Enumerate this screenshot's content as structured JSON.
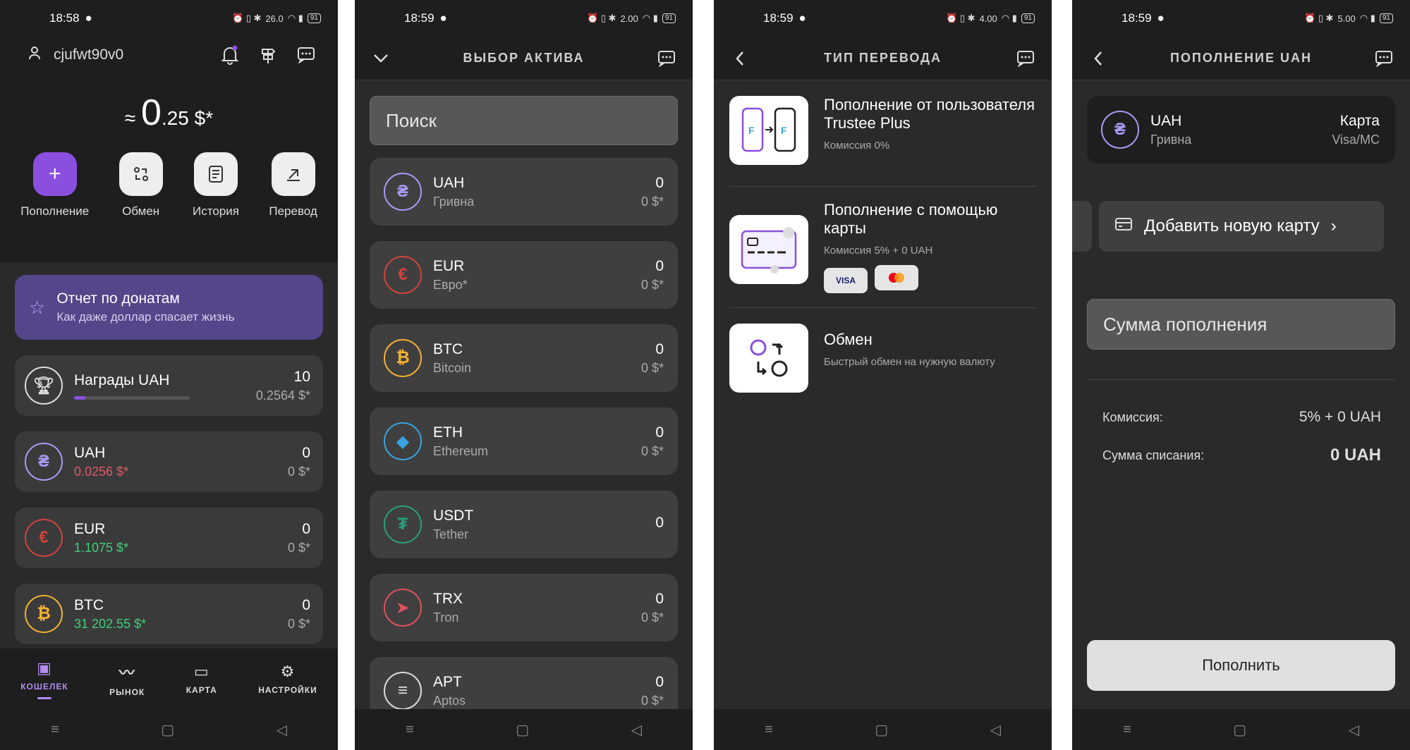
{
  "status": {
    "s1_time": "18:58",
    "s2_time": "18:59",
    "s3_time": "18:59",
    "s4_time": "18:59",
    "net1": "26.0",
    "net2": "2.00",
    "net3": "4.00",
    "net4": "5.00",
    "battery": "91"
  },
  "wallet": {
    "username": "cjufwt90v0",
    "balance_prefix": "≈",
    "balance_int": "0",
    "balance_dec": ".25 $*",
    "actions": [
      {
        "label": "Пополнение"
      },
      {
        "label": "Обмен"
      },
      {
        "label": "История"
      },
      {
        "label": "Перевод"
      }
    ],
    "banner": {
      "title": "Отчет по донатам",
      "subtitle": "Как даже доллар спасает жизнь"
    },
    "rewards": {
      "name": "Награды UAH",
      "amount": "10",
      "usd": "0.2564 $*",
      "progress": 0.1
    },
    "assets": [
      {
        "name": "UAH",
        "rate": "0.0256 $*",
        "amount": "0",
        "usd": "0 $*",
        "rate_color": "#e05a6a"
      },
      {
        "name": "EUR",
        "rate": "1.1075 $*",
        "amount": "0",
        "usd": "0 $*",
        "rate_color": "#3ecf7a"
      },
      {
        "name": "BTC",
        "rate": "31 202.55 $*",
        "amount": "0",
        "usd": "0 $*",
        "rate_color": "#3ecf7a"
      }
    ],
    "tabs": [
      {
        "label": "КОШЕЛЕК"
      },
      {
        "label": "РЫНОК"
      },
      {
        "label": "КАРТА"
      },
      {
        "label": "НАСТРОЙКИ"
      }
    ]
  },
  "asset_select": {
    "title": "ВЫБОР АКТИВА",
    "search_placeholder": "Поиск",
    "items": [
      {
        "code": "UAH",
        "name": "Гривна",
        "amount": "0",
        "usd": "0 $*"
      },
      {
        "code": "EUR",
        "name": "Евро*",
        "amount": "0",
        "usd": "0 $*"
      },
      {
        "code": "BTC",
        "name": "Bitcoin",
        "amount": "0",
        "usd": "0 $*"
      },
      {
        "code": "ETH",
        "name": "Ethereum",
        "amount": "0",
        "usd": "0 $*"
      },
      {
        "code": "USDT",
        "name": "Tether",
        "amount": "0",
        "usd": ""
      },
      {
        "code": "TRX",
        "name": "Tron",
        "amount": "0",
        "usd": "0 $*"
      },
      {
        "code": "APT",
        "name": "Aptos",
        "amount": "0",
        "usd": "0 $*"
      }
    ]
  },
  "transfer_type": {
    "title": "ТИП ПЕРЕВОДА",
    "options": [
      {
        "title": "Пополнение от пользователя Trustee Plus",
        "subtitle": "Комиссия 0%"
      },
      {
        "title": "Пополнение с помощью карты",
        "subtitle": "Комиссия 5% + 0 UAH",
        "badges": [
          "VISA",
          ""
        ]
      },
      {
        "title": "Обмен",
        "subtitle": "Быстрый обмен на нужную валюту"
      }
    ]
  },
  "topup": {
    "title": "ПОПОЛНЕНИЕ UAH",
    "currency_code": "UAH",
    "currency_name": "Гривна",
    "method_title": "Карта",
    "method_sub": "Visa/MC",
    "add_card": "Добавить новую карту",
    "amount_placeholder": "Сумма пополнения",
    "fee_label": "Комиссия:",
    "fee_value": "5% + 0 UAH",
    "debit_label": "Сумма списания:",
    "debit_value": "0 UAH",
    "button": "Пополнить"
  },
  "colors": {
    "accent": "#8b4fe0",
    "uah": "#a99af5",
    "eur": "#d0443c",
    "btc": "#f2b233",
    "eth": "#3aa3e0",
    "usdt": "#26a17b",
    "trx": "#e0505a"
  }
}
